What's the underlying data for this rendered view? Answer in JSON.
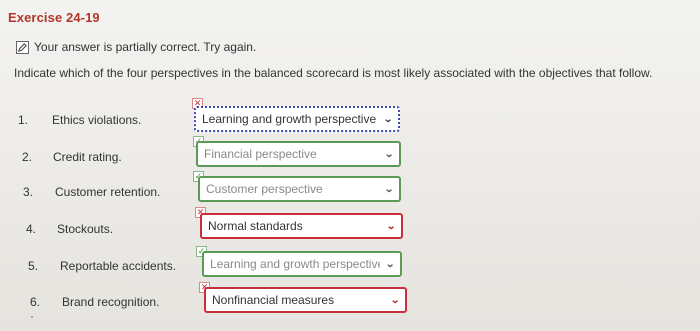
{
  "exercise": {
    "title": "Exercise 24-19"
  },
  "status": {
    "message": "Your answer is partially correct.  Try again.",
    "icon": "pencil-edit-icon"
  },
  "instructions": "Indicate which of the four perspectives in the balanced scorecard is most likely associated with the objectives that follow.",
  "rows": [
    {
      "number": "1.",
      "objective": "Ethics violations.",
      "selected": "Learning and growth perspective",
      "result": "incorrect",
      "state": "focused"
    },
    {
      "number": "2.",
      "objective": "Credit rating.",
      "selected": "Financial perspective",
      "result": "correct",
      "state": "normal"
    },
    {
      "number": "3.",
      "objective": "Customer retention.",
      "selected": "Customer perspective",
      "result": "correct",
      "state": "normal"
    },
    {
      "number": "4.",
      "objective": "Stockouts.",
      "selected": "Normal standards",
      "result": "incorrect",
      "state": "normal"
    },
    {
      "number": "5.",
      "objective": "Reportable accidents.",
      "selected": "Learning and growth perspective",
      "result": "correct",
      "state": "normal"
    },
    {
      "number": "6. ·",
      "objective": "Brand recognition.",
      "selected": "Nonfinancial measures",
      "result": "incorrect",
      "state": "normal"
    }
  ],
  "colors": {
    "title_red": "#b3372b",
    "correct_green": "#5c9a56",
    "incorrect_red": "#c92f3a",
    "focus_blue": "#3b4bb0"
  }
}
